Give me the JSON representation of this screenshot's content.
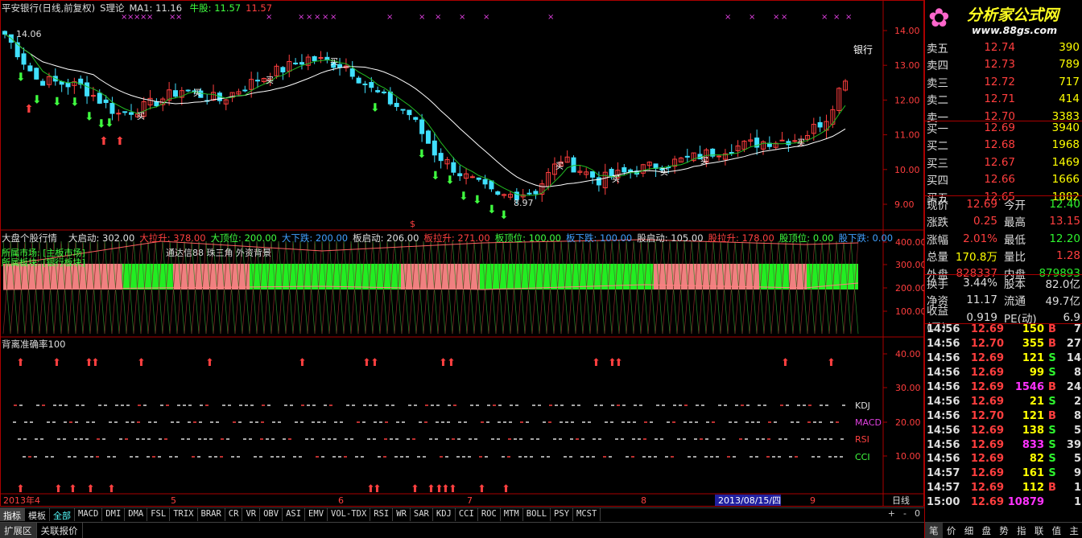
{
  "header": {
    "title": "平安银行(日线,前复权)",
    "formula": "S理论",
    "ma_label": "MA1: 11.16",
    "bull_label": "牛股: 11.57",
    "bull_value": "11.57"
  },
  "main_chart": {
    "price_ticks": [
      "14.00",
      "13.00",
      "12.00",
      "11.00",
      "10.00",
      "9.00"
    ],
    "high_label": "14.06",
    "low_label": "8.97",
    "sector_label": "银行",
    "buy_label": "买",
    "marker_symbol": "$"
  },
  "indicator1": {
    "name": "大盘个股行情",
    "items": [
      {
        "label": "大启动: 302.00",
        "color": "#e0e0e0"
      },
      {
        "label": "大拉升: 378.00",
        "color": "#ff4040"
      },
      {
        "label": "大顶位: 200.00",
        "color": "#40ff40"
      },
      {
        "label": "大下跌: 200.00",
        "color": "#40a0ff"
      },
      {
        "label": "板启动: 206.00",
        "color": "#e0e0e0"
      },
      {
        "label": "板拉升: 271.00",
        "color": "#ff4040"
      },
      {
        "label": "板顶位: 100.00",
        "color": "#40ff40"
      },
      {
        "label": "板下跌: 100.00",
        "color": "#40a0ff"
      },
      {
        "label": "股启动: 105.00",
        "color": "#e0e0e0"
      },
      {
        "label": "股拉升: 178.00",
        "color": "#ff4040"
      },
      {
        "label": "股顶位: 0.00",
        "color": "#40ff40"
      },
      {
        "label": "股下跌: 0.00",
        "color": "#40a0ff"
      }
    ],
    "market_label": "所属市场: [主板市场]",
    "sector_label": "所属板块: [银行板块]",
    "note": "通达信88 珠三角 外资背景",
    "ticks": [
      "400.00",
      "300.00",
      "200.00",
      "100.00"
    ]
  },
  "indicator2": {
    "name": "背离准确率100",
    "ticks": [
      "40.00",
      "30.00",
      "20.00",
      "10.00"
    ],
    "line_labels": [
      "KDJ",
      "MACD",
      "RSI",
      "CCI"
    ]
  },
  "x_axis": {
    "labels": [
      "2013年4",
      "5",
      "6",
      "7",
      "8",
      "9"
    ],
    "cursor_date": "2013/08/15/四",
    "period": "日线"
  },
  "tabs": [
    "指标",
    "模板",
    "全部",
    "MACD",
    "DMI",
    "DMA",
    "FSL",
    "TRIX",
    "BRAR",
    "CR",
    "VR",
    "OBV",
    "ASI",
    "EMV",
    "VOL-TDX",
    "RSI",
    "WR",
    "SAR",
    "KDJ",
    "CCI",
    "ROC",
    "MTM",
    "BOLL",
    "PSY",
    "MCST"
  ],
  "tab_controls": [
    "+",
    "-",
    "0"
  ],
  "bottom_tabs": [
    "扩展区",
    "关联报价"
  ],
  "logo": {
    "title": "分析家公式网",
    "url": "www.88gs.com"
  },
  "order_book": {
    "sell": [
      {
        "label": "卖五",
        "price": "12.74",
        "vol": "390"
      },
      {
        "label": "卖四",
        "price": "12.73",
        "vol": "789"
      },
      {
        "label": "卖三",
        "price": "12.72",
        "vol": "717"
      },
      {
        "label": "卖二",
        "price": "12.71",
        "vol": "414"
      },
      {
        "label": "卖一",
        "price": "12.70",
        "vol": "3383"
      }
    ],
    "buy": [
      {
        "label": "买一",
        "price": "12.69",
        "vol": "3940"
      },
      {
        "label": "买二",
        "price": "12.68",
        "vol": "1968"
      },
      {
        "label": "买三",
        "price": "12.67",
        "vol": "1469"
      },
      {
        "label": "买四",
        "price": "12.66",
        "vol": "1666"
      },
      {
        "label": "买五",
        "price": "12.65",
        "vol": "1882"
      }
    ]
  },
  "quote1": [
    {
      "l1": "现价",
      "v1": "12.69",
      "c1": "red",
      "l2": "今开",
      "v2": "12.40",
      "c2": "grn"
    },
    {
      "l1": "涨跌",
      "v1": "0.25",
      "c1": "red",
      "l2": "最高",
      "v2": "13.15",
      "c2": "red"
    },
    {
      "l1": "涨幅",
      "v1": "2.01%",
      "c1": "red",
      "l2": "最低",
      "v2": "12.20",
      "c2": "grn"
    },
    {
      "l1": "总量",
      "v1": "170.8万",
      "c1": "yel",
      "l2": "量比",
      "v2": "1.28",
      "c2": "red"
    },
    {
      "l1": "外盘",
      "v1": "828337",
      "c1": "red",
      "l2": "内盘",
      "v2": "879893",
      "c2": "grn"
    }
  ],
  "quote2": [
    {
      "l1": "换手",
      "v1": "3.44%",
      "c1": "wht",
      "l2": "股本",
      "v2": "82.0亿",
      "c2": "wht"
    },
    {
      "l1": "净资",
      "v1": "11.17",
      "c1": "wht",
      "l2": "流通",
      "v2": "49.7亿",
      "c2": "wht"
    },
    {
      "l1": "收益(二)",
      "v1": "0.919",
      "c1": "wht",
      "l2": "PE(动)",
      "v2": "6.9",
      "c2": "wht"
    }
  ],
  "ticks": [
    {
      "t": "14:56",
      "p": "12.69",
      "pc": "red",
      "v": "150",
      "vc": "yel",
      "s": "B",
      "sc": "red",
      "n": "7"
    },
    {
      "t": "14:56",
      "p": "12.70",
      "pc": "red",
      "v": "355",
      "vc": "yel",
      "s": "B",
      "sc": "red",
      "n": "27"
    },
    {
      "t": "14:56",
      "p": "12.69",
      "pc": "red",
      "v": "121",
      "vc": "yel",
      "s": "S",
      "sc": "grn",
      "n": "14"
    },
    {
      "t": "14:56",
      "p": "12.69",
      "pc": "red",
      "v": "99",
      "vc": "yel",
      "s": "S",
      "sc": "grn",
      "n": "8"
    },
    {
      "t": "14:56",
      "p": "12.69",
      "pc": "red",
      "v": "1546",
      "vc": "mag",
      "s": "B",
      "sc": "red",
      "n": "24"
    },
    {
      "t": "14:56",
      "p": "12.69",
      "pc": "red",
      "v": "21",
      "vc": "yel",
      "s": "S",
      "sc": "grn",
      "n": "2"
    },
    {
      "t": "14:56",
      "p": "12.70",
      "pc": "red",
      "v": "121",
      "vc": "yel",
      "s": "B",
      "sc": "red",
      "n": "8"
    },
    {
      "t": "14:56",
      "p": "12.69",
      "pc": "red",
      "v": "138",
      "vc": "yel",
      "s": "S",
      "sc": "grn",
      "n": "5"
    },
    {
      "t": "14:56",
      "p": "12.69",
      "pc": "red",
      "v": "833",
      "vc": "mag",
      "s": "S",
      "sc": "grn",
      "n": "39"
    },
    {
      "t": "14:56",
      "p": "12.69",
      "pc": "red",
      "v": "82",
      "vc": "yel",
      "s": "S",
      "sc": "grn",
      "n": "5"
    },
    {
      "t": "14:57",
      "p": "12.69",
      "pc": "red",
      "v": "161",
      "vc": "yel",
      "s": "S",
      "sc": "grn",
      "n": "9"
    },
    {
      "t": "14:57",
      "p": "12.69",
      "pc": "red",
      "v": "112",
      "vc": "yel",
      "s": "B",
      "sc": "red",
      "n": "1"
    },
    {
      "t": "15:00",
      "p": "12.69",
      "pc": "red",
      "v": "10879",
      "vc": "mag",
      "s": "",
      "sc": "red",
      "n": "1"
    }
  ],
  "right_tabs": [
    "笔",
    "价",
    "细",
    "盘",
    "势",
    "指",
    "联",
    "值",
    "主"
  ],
  "colors": {
    "up": "#ff3e3e",
    "down": "#2ef22e",
    "frame": "#aa0000",
    "ma_white": "#ffffff",
    "ma_green": "#22bb22"
  }
}
